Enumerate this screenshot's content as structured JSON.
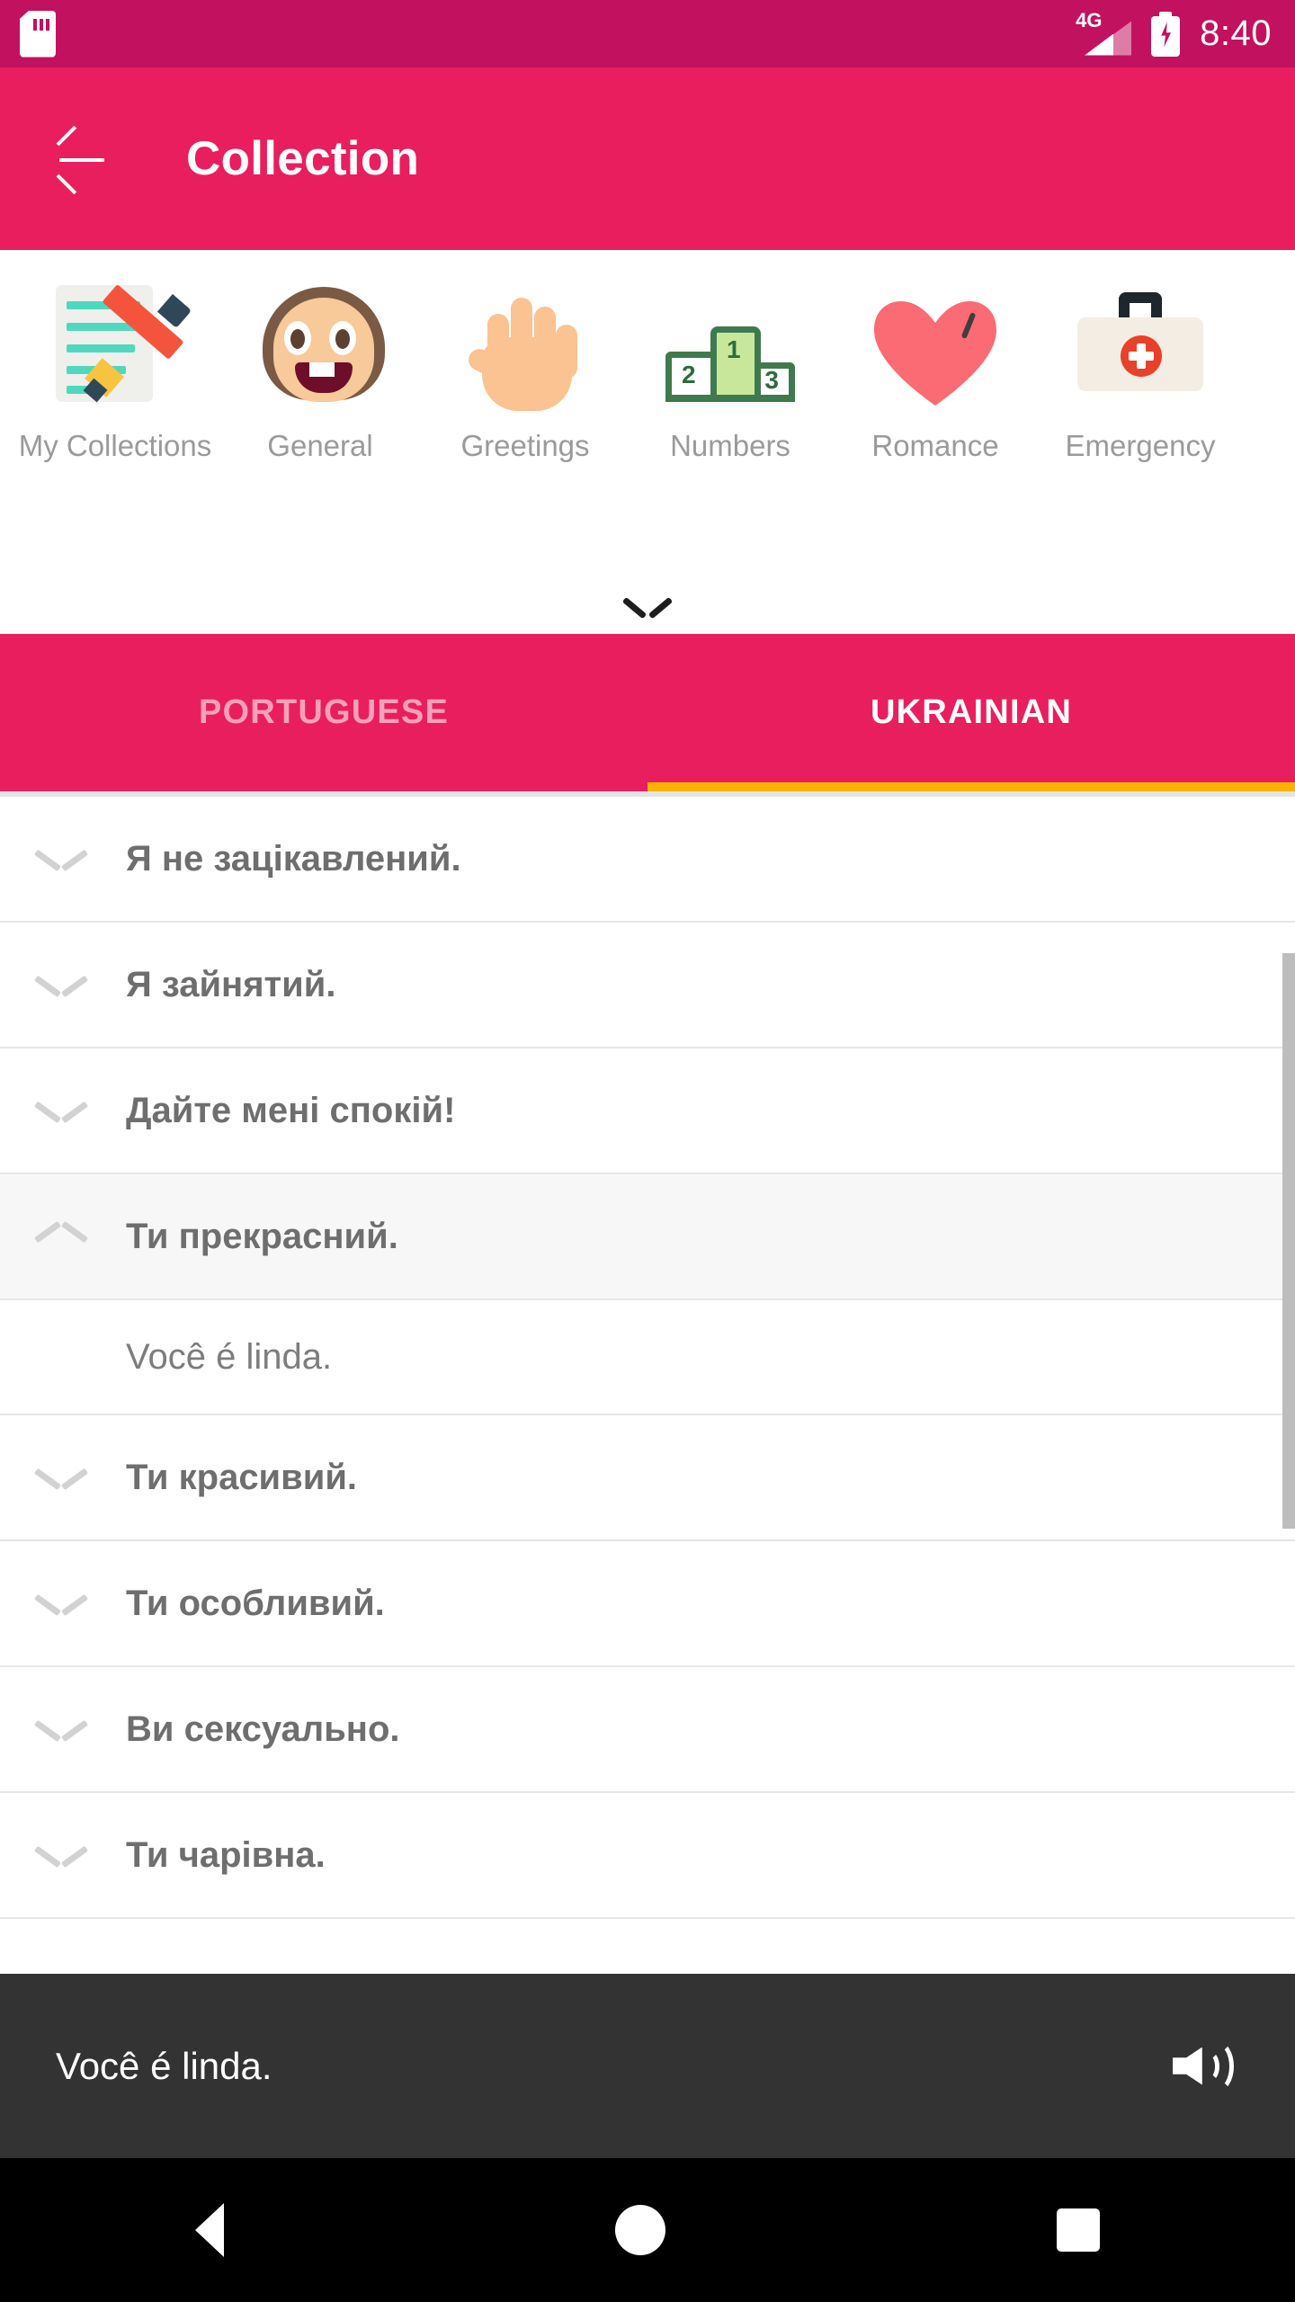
{
  "status_bar": {
    "sd_card_icon": "sd-card-icon",
    "network_label": "4G",
    "signal_icon": "signal-bars-icon",
    "battery_icon": "battery-charging-icon",
    "time": "8:40",
    "background_color": "#C2115F"
  },
  "app_bar": {
    "back_icon": "back-arrow-icon",
    "title": "Collection",
    "background_color": "#E91E5F"
  },
  "categories": {
    "expander_icon": "chevron-down-icon",
    "items": [
      {
        "label": "My Collections",
        "icon": "notepad-pencil-icon"
      },
      {
        "label": "General",
        "icon": "smiling-face-icon"
      },
      {
        "label": "Greetings",
        "icon": "open-hand-icon"
      },
      {
        "label": "Numbers",
        "icon": "podium-123-icon"
      },
      {
        "label": "Romance",
        "icon": "heart-icon"
      },
      {
        "label": "Emergency",
        "icon": "first-aid-kit-icon"
      }
    ]
  },
  "tabs": {
    "indicator_color": "#FFB300",
    "items": [
      {
        "label": "PORTUGUESE",
        "active": false
      },
      {
        "label": "UKRAINIAN",
        "active": true
      }
    ]
  },
  "phrase_list": {
    "rows": [
      {
        "text": "Я не зацікавлений.",
        "expanded": false,
        "chevron": "chevron-down-icon"
      },
      {
        "text": "Я зайнятий.",
        "expanded": false,
        "chevron": "chevron-down-icon"
      },
      {
        "text": "Дайте мені спокій!",
        "expanded": false,
        "chevron": "chevron-down-icon"
      },
      {
        "text": "Ти прекрасний.",
        "expanded": true,
        "chevron": "chevron-up-icon"
      },
      {
        "text": "Você é linda.",
        "translation": true
      },
      {
        "text": "Ти красивий.",
        "expanded": false,
        "chevron": "chevron-down-icon"
      },
      {
        "text": "Ти особливий.",
        "expanded": false,
        "chevron": "chevron-down-icon"
      },
      {
        "text": "Ви сексуально.",
        "expanded": false,
        "chevron": "chevron-down-icon"
      },
      {
        "text": "Ти чарівна.",
        "expanded": false,
        "chevron": "chevron-down-icon"
      }
    ]
  },
  "player_bar": {
    "text": "Você é linda.",
    "speaker_icon": "speaker-volume-icon",
    "background_color": "#333333"
  },
  "nav_bar": {
    "back_icon": "nav-back-triangle-icon",
    "home_icon": "nav-home-circle-icon",
    "recents_icon": "nav-recents-square-icon"
  }
}
